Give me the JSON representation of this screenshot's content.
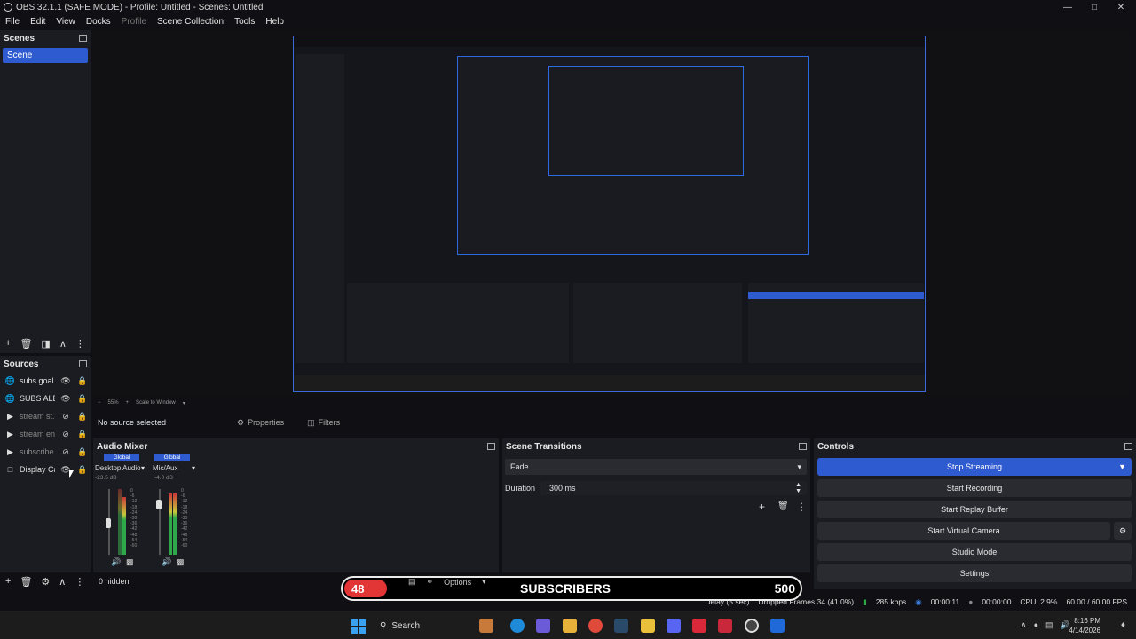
{
  "window": {
    "title": "OBS 32.1.1 (SAFE MODE) - Profile: Untitled - Scenes: Untitled"
  },
  "menu": [
    "File",
    "Edit",
    "View",
    "Docks",
    "Profile",
    "Scene Collection",
    "Tools",
    "Help"
  ],
  "scenes": {
    "header": "Scenes",
    "items": [
      "Scene"
    ]
  },
  "sources": {
    "header": "Sources",
    "items": [
      {
        "name": "subs goal",
        "icon": "globe-icon",
        "visible": true
      },
      {
        "name": "SUBS ALERT",
        "icon": "globe-icon",
        "visible": true
      },
      {
        "name": "stream st...",
        "icon": "play-icon",
        "visible": false
      },
      {
        "name": "stream en...",
        "icon": "play-icon",
        "visible": false
      },
      {
        "name": "subscribe",
        "icon": "play-icon",
        "visible": false
      },
      {
        "name": "Display Ca...",
        "icon": "monitor-icon",
        "visible": true
      }
    ]
  },
  "preview": {
    "zoom": "55%",
    "scale_label": "Scale to Window"
  },
  "context": {
    "no_source": "No source selected",
    "properties": "Properties",
    "filters": "Filters"
  },
  "audio_mixer": {
    "header": "Audio Mixer",
    "hidden_label": "0 hidden",
    "channels": [
      {
        "global": "Global",
        "name": "Desktop Audio",
        "db": "-23.5 dB"
      },
      {
        "global": "Global",
        "name": "Mic/Aux",
        "db": "-4.0 dB"
      }
    ],
    "ticks": [
      "0",
      "-6",
      "-12",
      "-18",
      "-24",
      "-30",
      "-36",
      "-42",
      "-48",
      "-54",
      "-60"
    ]
  },
  "transitions": {
    "header": "Scene Transitions",
    "selected": "Fade",
    "duration_label": "Duration",
    "duration_value": "300 ms"
  },
  "controls": {
    "header": "Controls",
    "buttons": [
      "Stop Streaming",
      "Start Recording",
      "Start Replay Buffer",
      "Start Virtual Camera",
      "Studio Mode",
      "Settings"
    ]
  },
  "overlay": {
    "count": "48",
    "options": "Options",
    "label": "SUBSCRIBERS",
    "goal": "500"
  },
  "status": {
    "delay": "Delay (5 sec)",
    "dropped": "Dropped Frames 34 (41.0%)",
    "bitrate": "285 kbps",
    "stream_time": "00:00:11",
    "rec_time": "00:00:00",
    "cpu": "CPU: 2.9%",
    "fps": "60.00 / 60.00 FPS"
  },
  "taskbar": {
    "search": "Search",
    "time": "8:16 PM",
    "date": "4/14/2026"
  },
  "colors": {
    "accent": "#2f5bd0",
    "panel": "#1b1c21",
    "alert_red": "#e23535"
  }
}
